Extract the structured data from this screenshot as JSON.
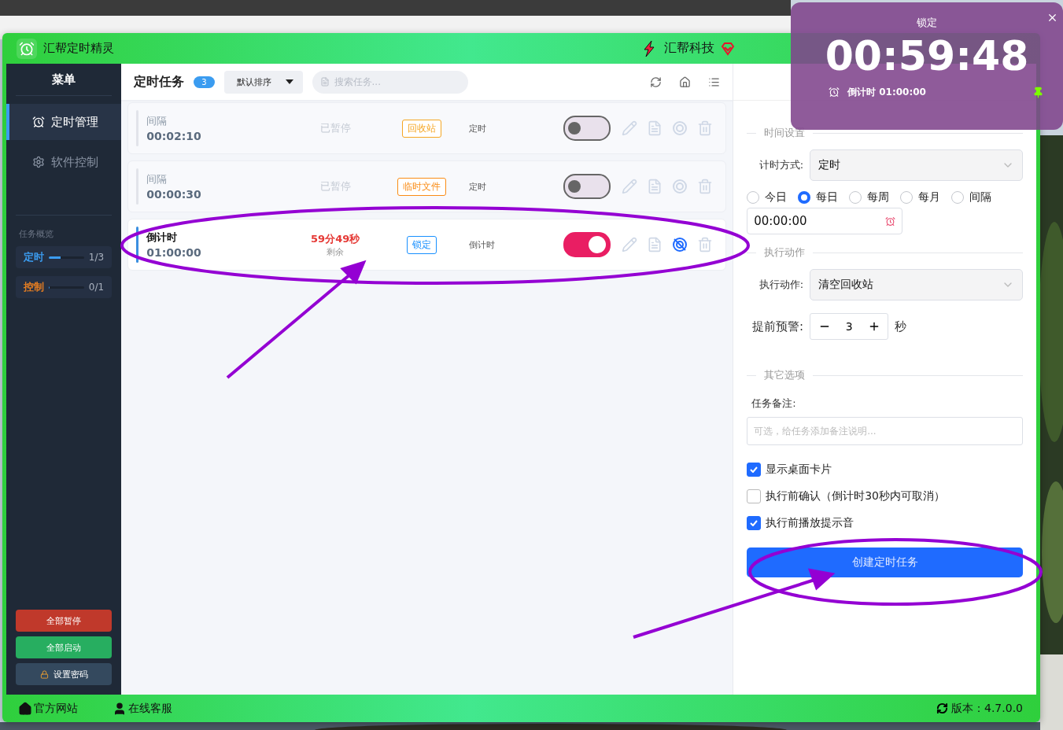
{
  "app": {
    "title": "汇帮定时精灵",
    "brand": "汇帮科技"
  },
  "sidebar": {
    "title": "菜单",
    "items": [
      {
        "label": "定时管理",
        "kind": "clock",
        "selected": true
      },
      {
        "label": "软件控制",
        "kind": "gear",
        "selected": false
      }
    ],
    "overview_title": "任务概览",
    "overview": [
      {
        "label": "定时",
        "count": "1/3",
        "level": 0.33,
        "color": "#3b9cf0"
      },
      {
        "label": "控制",
        "count": "0/1",
        "level": 0,
        "color": "#e67e22"
      }
    ],
    "buttons": [
      {
        "label": "全部暂停",
        "kind": "danger"
      },
      {
        "label": "全部启动",
        "kind": "success"
      },
      {
        "label": "设置密码",
        "kind": "lock"
      }
    ]
  },
  "tasks": {
    "title": "定时任务",
    "count": "3",
    "sort": "默认排序",
    "search_placeholder": "搜索任务...",
    "items": [
      {
        "type": "间隔",
        "time": "00:02:10",
        "status": "已暂停",
        "tag": "回收站",
        "color": "#f5a623",
        "mode": "定时",
        "on": false,
        "locked": false
      },
      {
        "type": "间隔",
        "time": "00:00:30",
        "status": "已暂停",
        "tag": "临时文件",
        "color": "#fa8c16",
        "mode": "定时",
        "on": false,
        "locked": false
      },
      {
        "type": "倒计时",
        "time": "01:00:00",
        "status": "59分49秒",
        "status_note": "剩余",
        "tag": "锁定",
        "color": "#1890ff",
        "mode": "倒计时",
        "on": true,
        "locked": true
      }
    ]
  },
  "form": {
    "time_section": "时间设置",
    "timing_label": "计时方式:",
    "timing_value": "定时",
    "repeat": [
      {
        "label": "今日",
        "selected": false
      },
      {
        "label": "每日",
        "selected": true
      },
      {
        "label": "每周",
        "selected": false
      },
      {
        "label": "每月",
        "selected": false
      },
      {
        "label": "间隔",
        "selected": false
      }
    ],
    "time_value": "00:00:00",
    "action_section": "执行动作",
    "action_label": "执行动作:",
    "action_value": "清空回收站",
    "warn_label": "提前预警:",
    "warn_value": "3",
    "warn_unit": "秒",
    "other_section": "其它选项",
    "note_label": "任务备注:",
    "note_placeholder": "可选，给任务添加备注说明...",
    "options": [
      {
        "label": "显示桌面卡片",
        "checked": true
      },
      {
        "label": "执行前确认（倒计时30秒内可取消）",
        "checked": false
      },
      {
        "label": "执行前播放提示音",
        "checked": true
      }
    ],
    "submit": "创建定时任务"
  },
  "footer": {
    "links": [
      {
        "label": "官方网站",
        "kind": "home"
      },
      {
        "label": "在线客服",
        "kind": "support"
      }
    ],
    "version": "版本：4.7.0.0"
  },
  "float_card": {
    "title": "锁定",
    "time": "00:59:48",
    "subtitle": "倒计时 01:00:00",
    "pinned": true
  }
}
